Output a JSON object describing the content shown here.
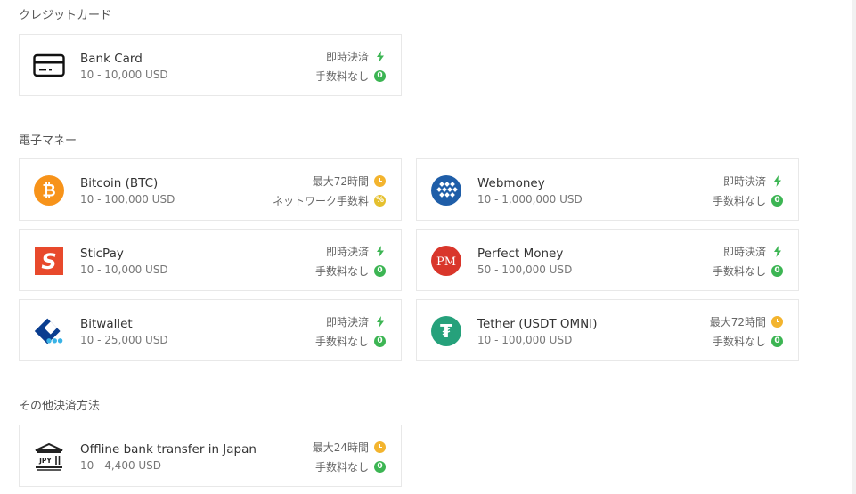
{
  "sections": {
    "credit": "クレジットカード",
    "emoney": "電子マネー",
    "other": "その他決済方法"
  },
  "cards": {
    "bankcard": {
      "name": "Bank Card",
      "range": "10 - 10,000 USD",
      "top": "即時決済",
      "bottom": "手数料なし",
      "zero": "0"
    },
    "bitcoin": {
      "name": "Bitcoin (BTC)",
      "range": "10 - 100,000 USD",
      "top": "最大72時間",
      "bottom": "ネットワーク手数料",
      "icon_text": "₿"
    },
    "webmoney": {
      "name": "Webmoney",
      "range": "10 - 1,000,000 USD",
      "top": "即時決済",
      "bottom": "手数料なし",
      "zero": "0"
    },
    "sticpay": {
      "name": "SticPay",
      "range": "10 - 10,000 USD",
      "top": "即時決済",
      "bottom": "手数料なし",
      "zero": "0",
      "icon_text": "S"
    },
    "perfect": {
      "name": "Perfect Money",
      "range": "50 - 100,000 USD",
      "top": "即時決済",
      "bottom": "手数料なし",
      "zero": "0",
      "icon_text": "PM"
    },
    "bitwallet": {
      "name": "Bitwallet",
      "range": "10 - 25,000 USD",
      "top": "即時決済",
      "bottom": "手数料なし",
      "zero": "0"
    },
    "tether": {
      "name": "Tether (USDT OMNI)",
      "range": "10 - 100,000 USD",
      "top": "最大72時間",
      "bottom": "手数料なし",
      "zero": "0",
      "icon_text": "₮"
    },
    "offline": {
      "name": "Offline bank transfer in Japan",
      "range": "10 - 4,400 USD",
      "top": "最大24時間",
      "bottom": "手数料なし",
      "zero": "0",
      "icon_text": "JPY"
    }
  },
  "colors": {
    "accent_green": "#3cb553",
    "clock_yellow": "#f3b42e",
    "bitcoin_orange": "#f7931a",
    "sticpay_red": "#e8492c",
    "perfect_red": "#d9362b",
    "tether_green": "#26a17b",
    "webmoney_blue": "#1f5ea8",
    "bitwallet_blue": "#0a3d8f"
  },
  "icons": [
    "credit-card-icon",
    "bitcoin-icon",
    "webmoney-icon",
    "sticpay-icon",
    "perfect-money-icon",
    "bitwallet-icon",
    "tether-icon",
    "bank-building-icon",
    "lightning-icon",
    "clock-icon",
    "zero-fee-icon",
    "percent-icon"
  ]
}
